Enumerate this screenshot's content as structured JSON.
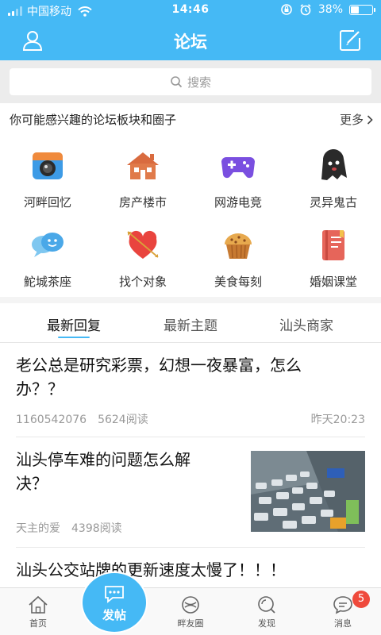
{
  "status_bar": {
    "carrier": "中国移动",
    "time": "14:46",
    "battery_percent": "38%",
    "battery_level": 0.38,
    "icons": [
      "signal-icon",
      "wifi-icon",
      "rotation-lock-icon",
      "alarm-icon",
      "battery-icon"
    ]
  },
  "header": {
    "title": "论坛",
    "left_icon": "user-icon",
    "right_icon": "compose-icon",
    "color": "#45b9f5"
  },
  "search": {
    "placeholder": "搜索",
    "icon": "search-icon"
  },
  "recommend": {
    "title": "你可能感兴趣的论坛板块和圈子",
    "more_label": "更多",
    "items": [
      {
        "label": "河畔回忆",
        "icon": "camera-icon"
      },
      {
        "label": "房产楼市",
        "icon": "house-icon"
      },
      {
        "label": "网游电竞",
        "icon": "gamepad-icon"
      },
      {
        "label": "灵异鬼古",
        "icon": "ghost-icon"
      },
      {
        "label": "鮀城茶座",
        "icon": "chat-bubbles-icon"
      },
      {
        "label": "找个对象",
        "icon": "heart-arrow-icon"
      },
      {
        "label": "美食每刻",
        "icon": "muffin-icon"
      },
      {
        "label": "婚姻课堂",
        "icon": "notebook-icon"
      }
    ]
  },
  "tabs": [
    {
      "label": "最新回复",
      "active": true
    },
    {
      "label": "最新主题",
      "active": false
    },
    {
      "label": "汕头商家",
      "active": false
    }
  ],
  "posts": [
    {
      "title_line1": "老公总是研究彩票，幻想一夜暴富，怎么",
      "title_line2": "办？？",
      "author": "1160542076",
      "views": "5624阅读",
      "time": "昨天20:23"
    },
    {
      "title_line1": "汕头停车难的问题怎么解",
      "title_line2": "决？",
      "author": "天主的爱",
      "views": "4398阅读",
      "thumbnail": "traffic-jam-photo"
    },
    {
      "title_line1": "汕头公交站牌的更新速度太慢了！！！"
    }
  ],
  "bottom_nav": {
    "items": [
      {
        "label": "首页",
        "icon": "home-icon"
      },
      {
        "label": "畔友圈",
        "icon": "circle-icon"
      },
      {
        "label": "发现",
        "icon": "discover-icon"
      },
      {
        "label": "消息",
        "icon": "message-icon"
      }
    ],
    "post_button_label": "发帖",
    "messages_badge": "5",
    "badge_color": "#ef4a3c"
  }
}
